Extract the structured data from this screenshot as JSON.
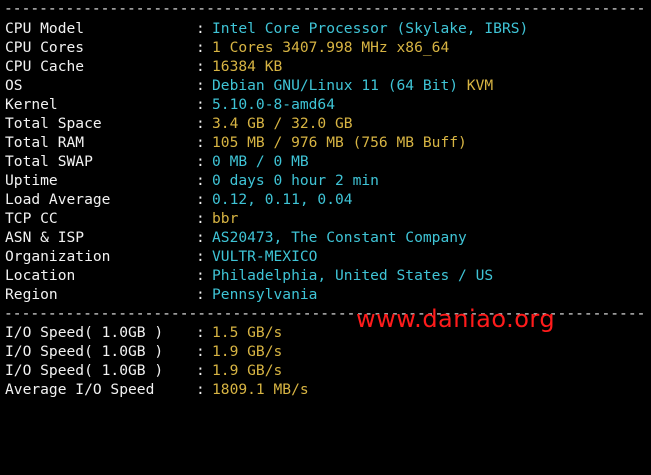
{
  "separator": "------------------------------------------------------------------------------",
  "system_info": [
    {
      "label": "CPU Model",
      "value": "Intel Core Processor (Skylake, IBRS)",
      "extra": ""
    },
    {
      "label": "CPU Cores",
      "value": "1 Cores 3407.998 MHz x86_64",
      "extra": ""
    },
    {
      "label": "CPU Cache",
      "value": "16384 KB",
      "extra": ""
    },
    {
      "label": "OS",
      "value": "Debian GNU/Linux 11 (64 Bit)",
      "extra": " KVM"
    },
    {
      "label": "Kernel",
      "value": "5.10.0-8-amd64",
      "extra": ""
    },
    {
      "label": "Total Space",
      "value": "3.4 GB / 32.0 GB",
      "extra": ""
    },
    {
      "label": "Total RAM",
      "value": "105 MB / 976 MB (756 MB Buff)",
      "extra": ""
    },
    {
      "label": "Total SWAP",
      "value": "0 MB / 0 MB",
      "extra": ""
    },
    {
      "label": "Uptime",
      "value": "0 days 0 hour 2 min",
      "extra": ""
    },
    {
      "label": "Load Average",
      "value": "0.12, 0.11, 0.04",
      "extra": ""
    },
    {
      "label": "TCP CC",
      "value": "bbr",
      "extra": ""
    },
    {
      "label": "ASN & ISP",
      "value": "AS20473, The Constant Company",
      "extra": ""
    },
    {
      "label": "Organization",
      "value": "VULTR-MEXICO",
      "extra": ""
    },
    {
      "label": "Location",
      "value": "Philadelphia, United States / US",
      "extra": ""
    },
    {
      "label": "Region",
      "value": "Pennsylvania",
      "extra": ""
    }
  ],
  "io_info": [
    {
      "label": "I/O Speed( 1.0GB )",
      "value": "1.5 GB/s"
    },
    {
      "label": "I/O Speed( 1.0GB )",
      "value": "1.9 GB/s"
    },
    {
      "label": "I/O Speed( 1.0GB )",
      "value": "1.9 GB/s"
    },
    {
      "label": "Average I/O Speed",
      "value": "1809.1 MB/s"
    }
  ],
  "colon": ":",
  "watermark": "www.daniao.org",
  "colors": {
    "background": "#000000",
    "label": "#f2f2f2",
    "value_cyan": "#3fc4d6",
    "value_yellow": "#d7b443",
    "watermark": "#ff1b1b"
  }
}
